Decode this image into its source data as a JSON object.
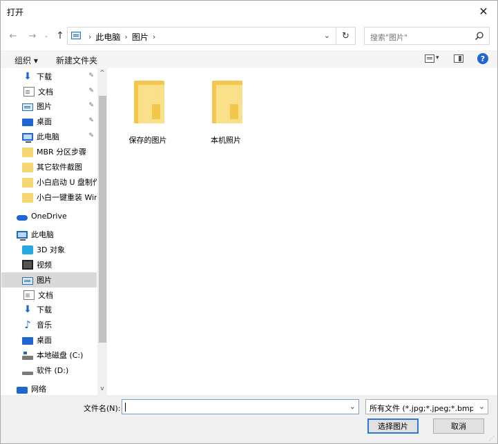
{
  "window": {
    "title": "打开",
    "close_glyph": "✕"
  },
  "nav": {
    "back_glyph": "←",
    "forward_glyph": "→",
    "recent_glyph": "⌄",
    "up_glyph": "↑",
    "breadcrumbs": [
      "此电脑",
      "图片"
    ],
    "crumb_sep": "›",
    "dropdown_glyph": "⌄",
    "refresh_glyph": "↻"
  },
  "search": {
    "placeholder": "搜索\"图片\""
  },
  "toolbar": {
    "organize_label": "组织 ▾",
    "newfolder_label": "新建文件夹",
    "view_arrow": "▾",
    "help_glyph": "?"
  },
  "sidebar": {
    "items": [
      {
        "label": "下载",
        "icon": "download-icon",
        "pinned": true
      },
      {
        "label": "文档",
        "icon": "document-icon",
        "pinned": true
      },
      {
        "label": "图片",
        "icon": "pictures-icon",
        "pinned": true
      },
      {
        "label": "桌面",
        "icon": "desktop-icon",
        "pinned": true
      },
      {
        "label": "此电脑",
        "icon": "computer-icon",
        "pinned": true
      },
      {
        "label": "MBR 分区步骤",
        "icon": "folder-icon"
      },
      {
        "label": "其它软件截图",
        "icon": "folder-icon"
      },
      {
        "label": "小白启动 U 盘制作",
        "icon": "folder-icon"
      },
      {
        "label": "小白一键重装 Win",
        "icon": "folder-icon"
      },
      {
        "label": "OneDrive",
        "icon": "cloud-icon"
      },
      {
        "label": "此电脑",
        "icon": "computer-icon"
      },
      {
        "label": "3D 对象",
        "icon": "3d-objects-icon"
      },
      {
        "label": "视频",
        "icon": "video-icon"
      },
      {
        "label": "图片",
        "icon": "pictures-icon",
        "selected": true
      },
      {
        "label": "文档",
        "icon": "document-icon"
      },
      {
        "label": "下载",
        "icon": "download-icon"
      },
      {
        "label": "音乐",
        "icon": "music-icon"
      },
      {
        "label": "桌面",
        "icon": "desktop-icon"
      },
      {
        "label": "本地磁盘 (C:)",
        "icon": "local-disk-icon"
      },
      {
        "label": "软件 (D:)",
        "icon": "drive-icon"
      },
      {
        "label": "网络",
        "icon": "network-icon"
      }
    ],
    "pin_glyph": "📌",
    "scroll_up": "^",
    "scroll_down": "v"
  },
  "content": {
    "folders": [
      {
        "name": "保存的图片"
      },
      {
        "name": "本机照片"
      }
    ]
  },
  "footer": {
    "filename_label": "文件名(N):",
    "filename_value": "",
    "filetype_value": "所有文件 (*.jpg;*.jpeg;*.bmp;*.",
    "dropdown_glyph": "⌄",
    "open_label": "选择图片",
    "cancel_label": "取消",
    "grip": "⋰"
  }
}
